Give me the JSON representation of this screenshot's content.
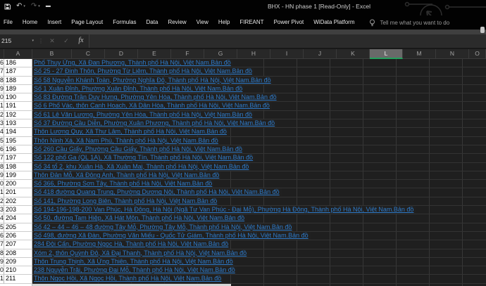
{
  "titlebar": {
    "title": "BHX - HN phase 1  [Read-Only] - Excel",
    "quick_access": [
      "save",
      "undo",
      "redo",
      "customize-quick-access"
    ]
  },
  "ribbon": {
    "tabs": [
      "File",
      "Home",
      "Insert",
      "Page Layout",
      "Formulas",
      "Data",
      "Review",
      "View",
      "Help",
      "FIREANT",
      "Power Pivot",
      "WiData Platform"
    ],
    "tell_me": "Tell me what you want to do"
  },
  "formula_bar": {
    "name_box": "215",
    "cancel_icon": "✕",
    "enter_icon": "✓",
    "fx_label": "fx",
    "formula_value": ""
  },
  "sheet": {
    "column_headers": [
      "A",
      "B",
      "C",
      "D",
      "E",
      "F",
      "G",
      "H",
      "I",
      "J",
      "K",
      "L",
      "M",
      "N",
      "O"
    ],
    "selected_column": "L",
    "rows": [
      {
        "num": 186,
        "address": "Phố Thuy Ứng, Xã Đan Phượng, Thành phố Hà Nội, Việt Nam.Bản đồ"
      },
      {
        "num": 187,
        "address": "Số 25 - 27 Đinh Thôn, Phường Từ Liêm, Thành phố Hà Nội, Việt Nam.Bản đồ"
      },
      {
        "num": 188,
        "address": "Số 58 Nguyễn Khánh Toàn, Phường Nghĩa Đô, Thành phố Hà Nội, Việt Nam.Bản đồ"
      },
      {
        "num": 189,
        "address": "Số 1 Xuân Đỉnh, Phường Xuân Đỉnh, Thành phố Hà Nội, Việt Nam.Bản đồ"
      },
      {
        "num": 190,
        "address": "Số 83 Đường Trần Duy Hưng, Phường Yên Hòa, Thành phố Hà Nội, Việt Nam.Bản đồ"
      },
      {
        "num": 191,
        "address": "Số 6 Phố Vác, thôn Canh Hoạch, Xã Dân Hòa, Thành phố Hà Nội, Việt Nam.Bản đồ"
      },
      {
        "num": 192,
        "address": "Số 61 Lê Văn Lương, Phường Yên Hòa, Thành phố Hà Nội, Việt Nam.Bản đồ"
      },
      {
        "num": 193,
        "address": "Số 37 Đường Cầu Diễn, Phường Xuân Phương, Thành phố Hà Nội, Việt Nam.Bản đồ"
      },
      {
        "num": 194,
        "address": "Thôn Lương Quy, Xã Thư Lâm, Thành phố Hà Nội, Việt Nam.Bản đồ"
      },
      {
        "num": 195,
        "address": "Thôn Ninh Xá, Xã Nam Phù, Thành phố Hà Nội, Việt Nam.Bản đồ"
      },
      {
        "num": 196,
        "address": "Số 260 Cầu Giấy, Phường Cầu Giấy, Thành phố Hà Nội, Việt Nam.Bản đồ"
      },
      {
        "num": 197,
        "address": "Số 122 phố Ga (QL 1A), Xã Thường Tín, Thành phố Hà Nội, Việt Nam.Bản đồ"
      },
      {
        "num": 198,
        "address": "Số 34 tổ 2, khu Xuân Hà, Xã Xuân Mai, Thành phố Hà Nội, Việt Nam.Bản đồ"
      },
      {
        "num": 199,
        "address": "Thôn Đản Mỗ, Xã Đông Anh, Thành phố Hà Nội, Việt Nam.Bản đồ"
      },
      {
        "num": 200,
        "address": "Số 366, Phường Sơn Tây, Thành phố Hà Nội, Việt Nam.Bản đồ"
      },
      {
        "num": 201,
        "address": "Số 418 đường Quang Trung, Phường Dương Nội, Thành phố Hà Nội, Việt Nam.Bản đồ"
      },
      {
        "num": 202,
        "address": "Số 141, Phường Long Biên, Thành phố Hà Nội, Việt Nam.Bản đồ"
      },
      {
        "num": 203,
        "address": "Số 194-196-198-200 Van Phúc, Hà Đông, Hà Nội (Ngã Tư Van Phúc - Đại Mỗ), Phường Hà Đông, Thành phố Hà Nội, Việt Nam.Bản đồ"
      },
      {
        "num": 204,
        "address": "Số 50, đường Tam Hiệp, Xã Hát Môn, Thành phố Hà Nội, Việt Nam.Bản đồ"
      },
      {
        "num": 205,
        "address": "Số 42 – 44 – 46 – 48 đường Tây Mỗ, Phường Tây Mỗ, Thành phố Hà Nội, Việt Nam.Bản đồ"
      },
      {
        "num": 206,
        "address": "Số 498, đường Xã Đàn, Phường Văn Miếu - Quốc Tử Giám, Thành phố Hà Nội, Việt Nam.Bản đồ"
      },
      {
        "num": 207,
        "address": "284 Đội Cấn, Phường Ngọc Hà, Thành phố Hà Nội, Việt Nam.Bản đồ"
      },
      {
        "num": 208,
        "address": "Xóm 2, thôn Quỳnh Đô, Xã Đại Thanh, Thành phố Hà Nội, Việt Nam.Bản đồ"
      },
      {
        "num": 209,
        "address": "Thôn Trung Thịnh, Xã Ứng Thiên, Thành phố Hà Nội, Việt Nam.Bản đồ"
      },
      {
        "num": 210,
        "address": "238 Nguyễn Trãi, Phường Đại Mỗ, Thành phố Hà Nội, Việt Nam.Bản đồ"
      },
      {
        "num": 211,
        "address": "Thôn Ngọc Hồi, Xã Ngọc Hồi, Thành phố Hà Nội, Việt Nam.Bản đồ"
      }
    ]
  },
  "colors": {
    "hyperlink_blue": "#2e7ac8",
    "selection_green": "#23a05c",
    "cell_fill_white": "#ffffff",
    "dark_background": "#202020"
  }
}
